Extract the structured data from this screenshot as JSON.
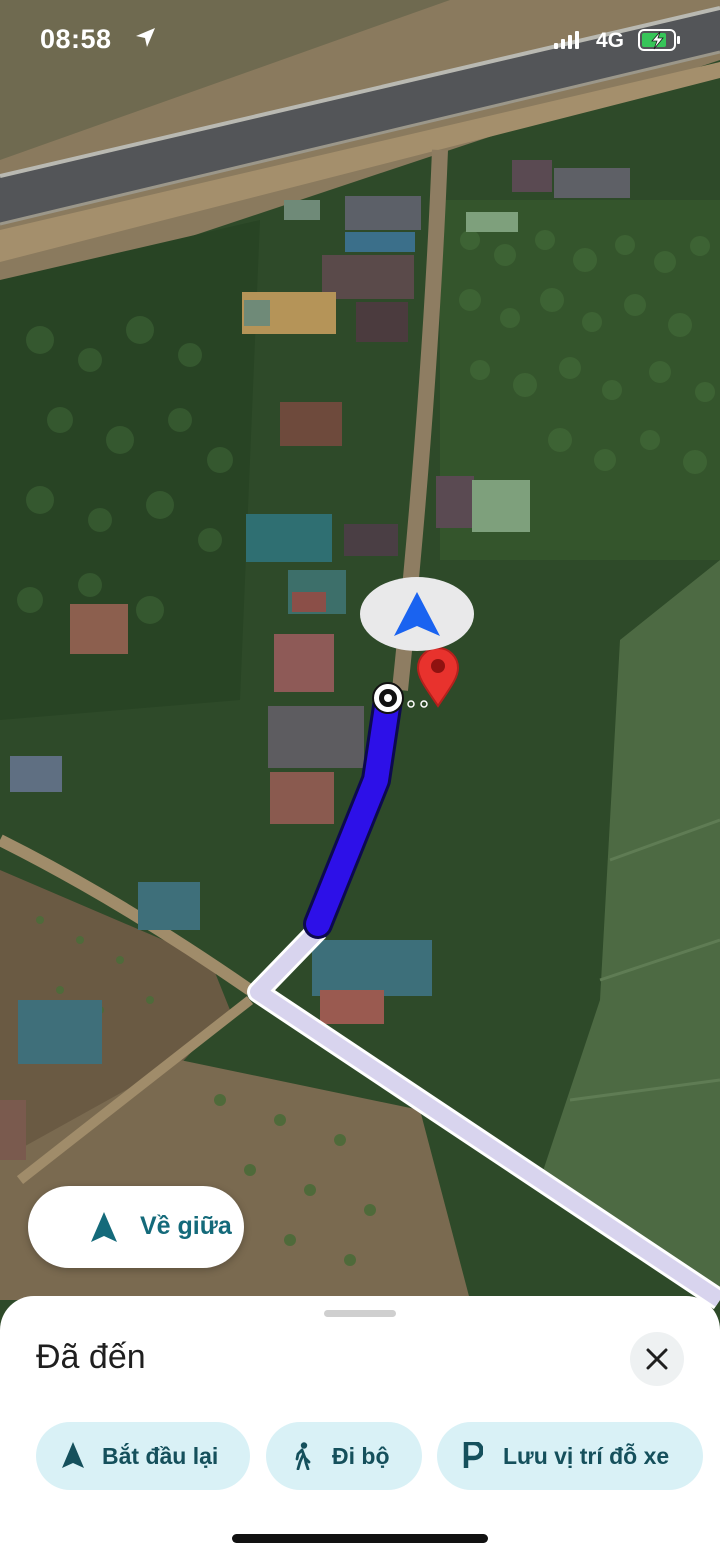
{
  "status_bar": {
    "time": "08:58",
    "network": "4G",
    "location_icon": "location-arrow-icon",
    "signal_icon": "signal-bars-icon",
    "battery_icon": "battery-charging-icon"
  },
  "map": {
    "view": "satellite",
    "completed_route_color": "#2d10e8",
    "upcoming_route_color": "#d8d4ee",
    "destination_pin_color": "#e8322d",
    "current_location_indicator_color": "#1a63f0"
  },
  "recenter_button": {
    "label": "Về giữa",
    "icon": "navigation-arrow-icon"
  },
  "bottom_sheet": {
    "title": "Đã đến",
    "close_icon": "close-icon",
    "actions": [
      {
        "label": "Bắt đầu lại",
        "icon": "navigation-arrow-icon"
      },
      {
        "label": "Đi bộ",
        "icon": "walking-icon"
      },
      {
        "label": "Lưu vị trí đỗ xe",
        "icon": "parking-icon"
      }
    ]
  }
}
